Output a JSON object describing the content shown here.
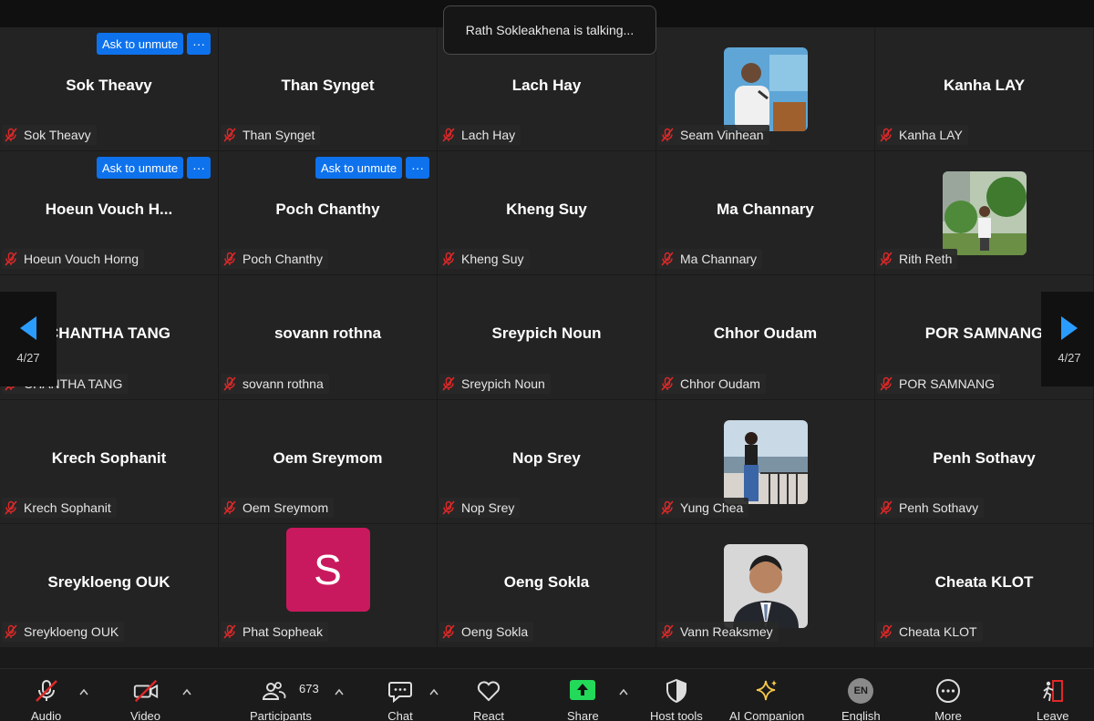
{
  "notification": {
    "talking": "Rath Sokleakhena is talking..."
  },
  "ask_unmute_label": "Ask to unmute",
  "more_label": "···",
  "tiles": [
    {
      "name": "Sok Theavy",
      "label": "Sok Theavy",
      "unmute": true
    },
    {
      "name": "Than Synget",
      "label": "Than Synget",
      "unmute": false
    },
    {
      "name": "Lach Hay",
      "label": "Lach Hay",
      "unmute": false
    },
    {
      "name": "",
      "label": "Seam Vinhean",
      "unmute": false,
      "photo": "speaker"
    },
    {
      "name": "Kanha LAY",
      "label": "Kanha LAY",
      "unmute": false
    },
    {
      "name": "Hoeun Vouch H...",
      "label": "Hoeun Vouch Horng",
      "unmute": true
    },
    {
      "name": "Poch Chanthy",
      "label": "Poch Chanthy",
      "unmute": true
    },
    {
      "name": "Kheng Suy",
      "label": "Kheng Suy",
      "unmute": false
    },
    {
      "name": "Ma Channary",
      "label": "Ma Channary",
      "unmute": false
    },
    {
      "name": "",
      "label": "Rith Reth",
      "unmute": false,
      "photo": "garden"
    },
    {
      "name": "CHANTHA TANG",
      "label": "CHANTHA TANG",
      "unmute": false
    },
    {
      "name": "sovann rothna",
      "label": "sovann rothna",
      "unmute": false
    },
    {
      "name": "Sreypich Noun",
      "label": "Sreypich Noun",
      "unmute": false
    },
    {
      "name": "Chhor Oudam",
      "label": "Chhor Oudam",
      "unmute": false
    },
    {
      "name": "POR SAMNANG",
      "label": "POR SAMNANG",
      "unmute": false
    },
    {
      "name": "Krech Sophanit",
      "label": "Krech Sophanit",
      "unmute": false
    },
    {
      "name": "Oem Sreymom",
      "label": "Oem Sreymom",
      "unmute": false
    },
    {
      "name": "Nop Srey",
      "label": "Nop Srey",
      "unmute": false
    },
    {
      "name": "",
      "label": "Yung Chea",
      "unmute": false,
      "photo": "river"
    },
    {
      "name": "Penh Sothavy",
      "label": "Penh Sothavy",
      "unmute": false
    },
    {
      "name": "Sreykloeng OUK",
      "label": "Sreykloeng OUK",
      "unmute": false
    },
    {
      "name": "",
      "label": "Phat Sopheak",
      "unmute": false,
      "letter": "S"
    },
    {
      "name": "Oeng Sokla",
      "label": "Oeng Sokla",
      "unmute": false
    },
    {
      "name": "",
      "label": "Vann Reaksmey",
      "unmute": false,
      "photo": "portrait"
    },
    {
      "name": "Cheata KLOT",
      "label": "Cheata KLOT",
      "unmute": false
    }
  ],
  "pagination": {
    "left": "4/27",
    "right": "4/27"
  },
  "toolbar": {
    "audio": "Audio",
    "video": "Video",
    "participants": "Participants",
    "participants_count": "673",
    "chat": "Chat",
    "react": "React",
    "share": "Share",
    "host_tools": "Host tools",
    "ai_companion": "AI Companion",
    "english": "English",
    "english_badge": "EN",
    "more": "More",
    "leave": "Leave"
  },
  "colors": {
    "accent_blue": "#0e72ed",
    "share_green": "#23d959",
    "mute_red": "#e02828",
    "avatar_pink": "#c9195e",
    "ai_gold": "#f5c84c"
  }
}
